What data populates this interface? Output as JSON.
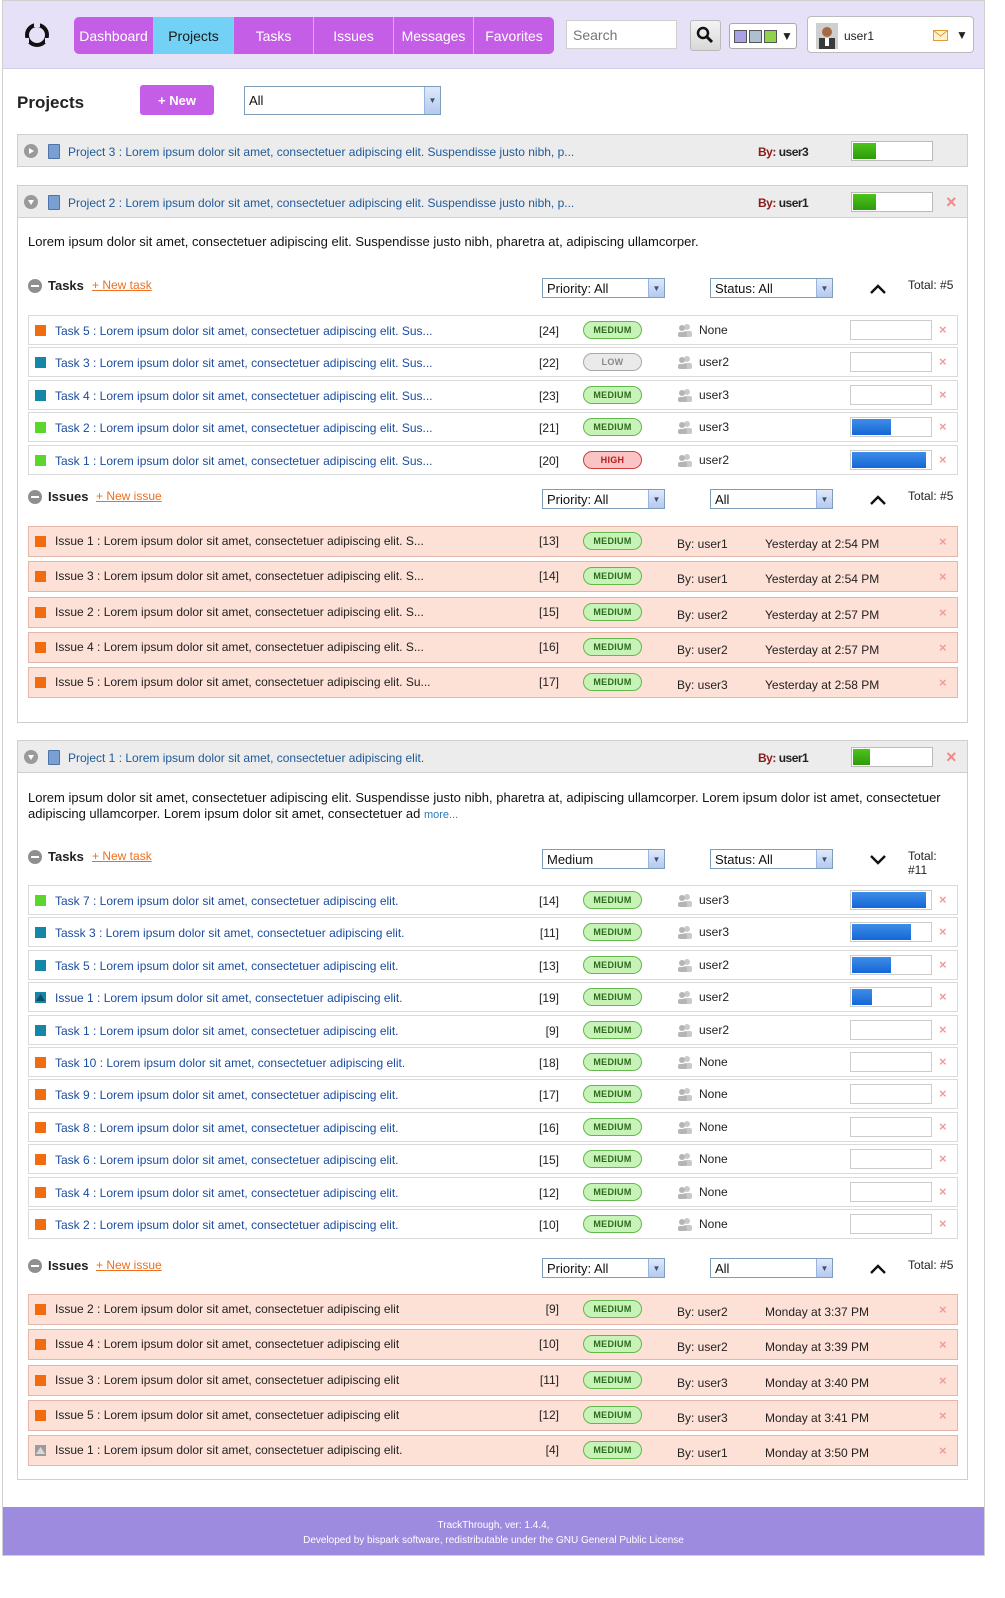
{
  "nav": {
    "tabs": [
      "Dashboard",
      "Projects",
      "Tasks",
      "Issues",
      "Messages",
      "Favorites"
    ],
    "active": "Projects"
  },
  "header": {
    "search_placeholder": "Search",
    "username": "user1",
    "theme_colors": [
      "#a9a1e8",
      "#aebfcf",
      "#8fd24c"
    ]
  },
  "page": {
    "title": "Projects",
    "new_label": "+ New",
    "filter": "All"
  },
  "projects": [
    {
      "title": "Project 3 : Lorem ipsum dolor sit amet, consectetuer adipiscing elit. Suspendisse justo nibh, p...",
      "by_label": "By:",
      "by_user": "user3",
      "progress": 0.3,
      "collapsed": true
    },
    {
      "title": "Project 2 : Lorem ipsum dolor sit amet, consectetuer adipiscing elit. Suspendisse justo nibh, p...",
      "by_label": "By:",
      "by_user": "user1",
      "progress": 0.3,
      "description": "Lorem ipsum dolor sit amet, consectetuer adipiscing elit. Suspendisse justo nibh, pharetra at, adipiscing ullamcorper.",
      "tasks": {
        "title": "Tasks",
        "new_label": "New task",
        "priority": "Priority: All",
        "status": "Status: All",
        "total": "Total: #5",
        "rows": [
          {
            "title": "Task 5 : Lorem ipsum dolor sit amet, consectetuer adipiscing elit. Sus...",
            "num": "[24]",
            "priority": "MEDIUM",
            "assignee": "None",
            "progress": 0,
            "color": "#f26b0f"
          },
          {
            "title": "Task 3 : Lorem ipsum dolor sit amet, consectetuer adipiscing elit. Sus...",
            "num": "[22]",
            "priority": "LOW",
            "assignee": "user2",
            "progress": 0,
            "color": "#1487a8"
          },
          {
            "title": "Task 4 : Lorem ipsum dolor sit amet, consectetuer adipiscing elit. Sus...",
            "num": "[23]",
            "priority": "MEDIUM",
            "assignee": "user3",
            "progress": 0,
            "color": "#1487a8"
          },
          {
            "title": "Task 2 : Lorem ipsum dolor sit amet, consectetuer adipiscing elit. Sus...",
            "num": "[21]",
            "priority": "MEDIUM",
            "assignee": "user3",
            "progress": 0.5,
            "color": "#5ad72a"
          },
          {
            "title": "Task 1 : Lorem ipsum dolor sit amet, consectetuer adipiscing elit. Sus...",
            "num": "[20]",
            "priority": "HIGH",
            "assignee": "user2",
            "progress": 0.95,
            "color": "#5ad72a"
          }
        ]
      },
      "issues": {
        "title": "Issues",
        "new_label": "New issue",
        "priority": "Priority: All",
        "status": "All",
        "total": "Total: #5",
        "rows": [
          {
            "title": "Issue 1 : Lorem ipsum dolor sit amet, consectetuer adipiscing elit. S...",
            "num": "[13]",
            "priority": "MEDIUM",
            "by": "By: user1",
            "date": "Yesterday at 2:54 PM"
          },
          {
            "title": "Issue 3 : Lorem ipsum dolor sit amet, consectetuer adipiscing elit. S...",
            "num": "[14]",
            "priority": "MEDIUM",
            "by": "By: user1",
            "date": "Yesterday at 2:54 PM"
          },
          {
            "title": "Issue 2 : Lorem ipsum dolor sit amet, consectetuer adipiscing elit. S...",
            "num": "[15]",
            "priority": "MEDIUM",
            "by": "By: user2",
            "date": "Yesterday at 2:57 PM"
          },
          {
            "title": "Issue 4 : Lorem ipsum dolor sit amet, consectetuer adipiscing elit. S...",
            "num": "[16]",
            "priority": "MEDIUM",
            "by": "By: user2",
            "date": "Yesterday at 2:57 PM"
          },
          {
            "title": "Issue 5 : Lorem ipsum dolor sit amet, consectetuer adipiscing elit. Su...",
            "num": "[17]",
            "priority": "MEDIUM",
            "by": "By: user3",
            "date": "Yesterday at 2:58 PM"
          }
        ]
      }
    },
    {
      "title": "Project 1 : Lorem ipsum dolor sit amet, consectetuer adipiscing elit.",
      "by_label": "By:",
      "by_user": "user1",
      "progress": 0.22,
      "description": "Lorem ipsum dolor sit amet, consectetuer adipiscing elit. Suspendisse justo nibh, pharetra at, adipiscing ullamcorper. Lorem ipsum dolor ist amet, consectetuer adipiscing ullamcorper. Lorem ipsum dolor sit amet, consectetuer ad",
      "more": "more...",
      "tasks": {
        "title": "Tasks",
        "new_label": "New task",
        "priority": "Medium",
        "status": "Status: All",
        "total": "Total: #11",
        "rows": [
          {
            "title": "Task 7 : Lorem ipsum dolor sit amet, consectetuer adipiscing elit.",
            "num": "[14]",
            "priority": "MEDIUM",
            "assignee": "user3",
            "progress": 0.95,
            "color": "#5ad72a"
          },
          {
            "title": "Tassk 3 : Lorem ipsum dolor sit amet, consectetuer adipiscing elit.",
            "num": "[11]",
            "priority": "MEDIUM",
            "assignee": "user3",
            "progress": 0.75,
            "color": "#1487a8"
          },
          {
            "title": "Task 5 : Lorem ipsum dolor sit amet, consectetuer adipiscing elit.",
            "num": "[13]",
            "priority": "MEDIUM",
            "assignee": "user2",
            "progress": 0.5,
            "color": "#1487a8"
          },
          {
            "title": "Issue 1 : Lorem ipsum dolor sit amet, consectetuer adipiscing elit.",
            "num": "[19]",
            "priority": "MEDIUM",
            "assignee": "user2",
            "progress": 0.25,
            "color": "#1487a8",
            "triangle": true
          },
          {
            "title": "Task 1 : Lorem ipsum dolor sit amet, consectetuer adipiscing elit.",
            "num": "[9]",
            "priority": "MEDIUM",
            "assignee": "user2",
            "progress": 0,
            "color": "#1487a8"
          },
          {
            "title": "Task 10 : Lorem ipsum dolor sit amet, consectetuer adipiscing elit.",
            "num": "[18]",
            "priority": "MEDIUM",
            "assignee": "None",
            "progress": 0,
            "color": "#f26b0f"
          },
          {
            "title": "Task 9 : Lorem ipsum dolor sit amet, consectetuer adipiscing elit.",
            "num": "[17]",
            "priority": "MEDIUM",
            "assignee": "None",
            "progress": 0,
            "color": "#f26b0f"
          },
          {
            "title": "Task 8 : Lorem ipsum dolor sit amet, consectetuer adipiscing elit.",
            "num": "[16]",
            "priority": "MEDIUM",
            "assignee": "None",
            "progress": 0,
            "color": "#f26b0f"
          },
          {
            "title": "Task 6 : Lorem ipsum dolor sit amet, consectetuer adipiscing elit.",
            "num": "[15]",
            "priority": "MEDIUM",
            "assignee": "None",
            "progress": 0,
            "color": "#f26b0f"
          },
          {
            "title": "Task 4 : Lorem ipsum dolor sit amet, consectetuer adipiscing elit.",
            "num": "[12]",
            "priority": "MEDIUM",
            "assignee": "None",
            "progress": 0,
            "color": "#f26b0f"
          },
          {
            "title": "Task 2 : Lorem ipsum dolor sit amet, consectetuer adipiscing elit.",
            "num": "[10]",
            "priority": "MEDIUM",
            "assignee": "None",
            "progress": 0,
            "color": "#f26b0f"
          }
        ]
      },
      "issues": {
        "title": "Issues",
        "new_label": "New issue",
        "priority": "Priority: All",
        "status": "All",
        "total": "Total: #5",
        "rows": [
          {
            "title": "Issue 2 : Lorem ipsum dolor sit amet, consectetuer adipiscing elit",
            "num": "[9]",
            "priority": "MEDIUM",
            "by": "By: user2",
            "date": "Monday at 3:37 PM"
          },
          {
            "title": "Issue 4 : Lorem ipsum dolor sit amet, consectetuer adipiscing elit",
            "num": "[10]",
            "priority": "MEDIUM",
            "by": "By: user2",
            "date": "Monday at 3:39 PM"
          },
          {
            "title": "Issue 3 : Lorem ipsum dolor sit amet, consectetuer adipiscing elit",
            "num": "[11]",
            "priority": "MEDIUM",
            "by": "By: user3",
            "date": "Monday at 3:40 PM"
          },
          {
            "title": "Issue 5 : Lorem ipsum dolor sit amet, consectetuer adipiscing elit",
            "num": "[12]",
            "priority": "MEDIUM",
            "by": "By: user3",
            "date": "Monday at 3:41 PM"
          },
          {
            "title": "Issue 1 : Lorem ipsum dolor sit amet, consectetuer adipiscing elit.",
            "num": "[4]",
            "priority": "MEDIUM",
            "by": "By: user1",
            "date": "Monday at 3:50 PM",
            "gray": true
          }
        ]
      }
    }
  ],
  "footer": {
    "line1": "TrackThrough, ver: 1.4.4,",
    "line2": "Developed by bispark software, redistributable under the GNU General Public License"
  }
}
